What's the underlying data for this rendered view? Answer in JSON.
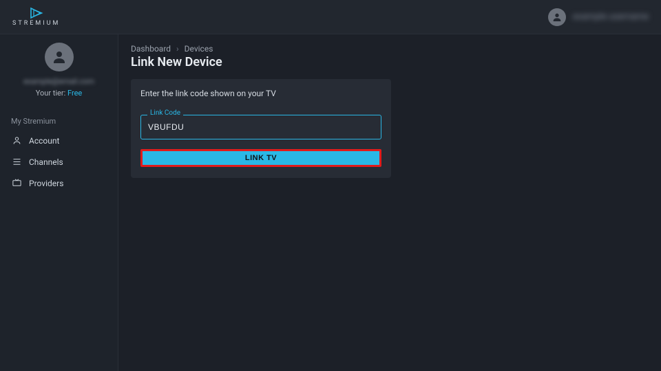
{
  "brand": {
    "name": "STREMIUM"
  },
  "topbar_user": {
    "name": "example username"
  },
  "sidebar": {
    "email_placeholder": "example@email.com",
    "tier_label": "Your tier: ",
    "tier_value": "Free",
    "heading": "My Stremium",
    "items": [
      {
        "label": "Account"
      },
      {
        "label": "Channels"
      },
      {
        "label": "Providers"
      }
    ]
  },
  "breadcrumb": [
    "Dashboard",
    "Devices"
  ],
  "page_title": "Link New Device",
  "card": {
    "instruction": "Enter the link code shown on your TV",
    "field_label": "Link Code",
    "field_value": "VBUFDU",
    "button_label": "LINK TV"
  },
  "colors": {
    "accent": "#2ab8e6",
    "highlight_border": "#e11b1b"
  }
}
